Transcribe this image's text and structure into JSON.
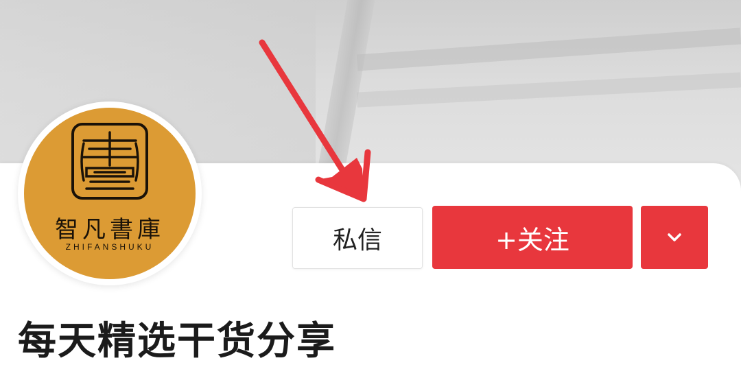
{
  "profile": {
    "avatar": {
      "logo_chinese": "智凡書庫",
      "logo_english": "ZHIFANSHUKU",
      "bg_color": "#dc9b34",
      "icon": "book-seal-icon"
    },
    "actions": {
      "message_label": "私信",
      "follow_label": "+关注",
      "more_icon": "chevron-down-icon",
      "accent_color": "#e8373d"
    },
    "bio": "每天精选干货分享"
  },
  "annotation": {
    "icon": "red-arrow-icon",
    "color": "#e8373d"
  }
}
